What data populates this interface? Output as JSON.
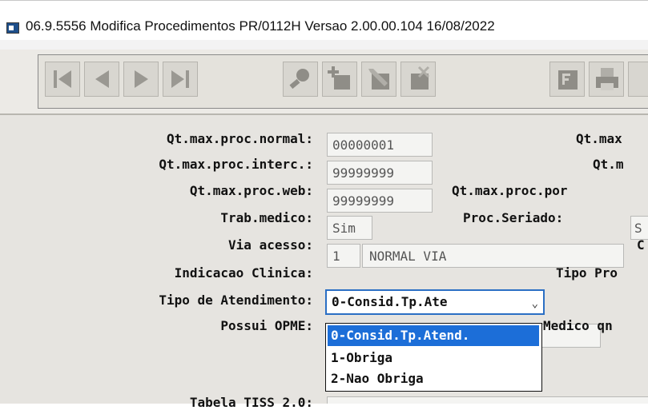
{
  "window": {
    "title": "06.9.5556  Modifica  Procedimentos PR/0112H Versao 2.00.00.104 16/08/2022"
  },
  "toolbar": {
    "buttons": [
      {
        "icon": "first-record-icon"
      },
      {
        "icon": "previous-record-icon"
      },
      {
        "icon": "next-record-icon"
      },
      {
        "icon": "last-record-icon"
      },
      {
        "icon": "search-icon"
      },
      {
        "icon": "add-record-icon"
      },
      {
        "icon": "edit-record-icon"
      },
      {
        "icon": "delete-record-icon"
      },
      {
        "icon": "filter-icon"
      },
      {
        "icon": "print-icon"
      }
    ]
  },
  "form": {
    "qt_max_normal": {
      "label": "Qt.max.proc.normal:",
      "value": "00000001",
      "right_label": "Qt.max"
    },
    "qt_max_interc": {
      "label": "Qt.max.proc.interc.:",
      "value": "99999999",
      "right_label": "Qt.m"
    },
    "qt_max_web": {
      "label": "Qt.max.proc.web:",
      "value": "99999999",
      "right_label": "Qt.max.proc.por"
    },
    "trab_medico": {
      "label": "Trab.medico:",
      "value": "Sim",
      "right_label": "Proc.Seriado:",
      "right_value": "S"
    },
    "via_acesso": {
      "label": "Via acesso:",
      "code": "1",
      "desc": "NORMAL VIA",
      "right_label": "C"
    },
    "indicacao_clinica": {
      "label": "Indicacao Clinica:",
      "selected": "0-Consid.Tp.Ate",
      "right_label": "Tipo Pro",
      "options": [
        "0-Consid.Tp.Atend.",
        "1-Obriga",
        "2-Nao Obriga"
      ]
    },
    "tipo_atendimento": {
      "label": "Tipo de Atendimento:"
    },
    "possui_opme": {
      "label": "Possui OPME:",
      "right_label": "Medico qn"
    },
    "tabela_tiss": {
      "label": "Tabela TISS 2.0:"
    }
  },
  "colors": {
    "accent": "#2b6fc4",
    "selected_option": "#1c6ed8",
    "panel": "#e6e4e0",
    "toolbar": "#eceae6"
  }
}
